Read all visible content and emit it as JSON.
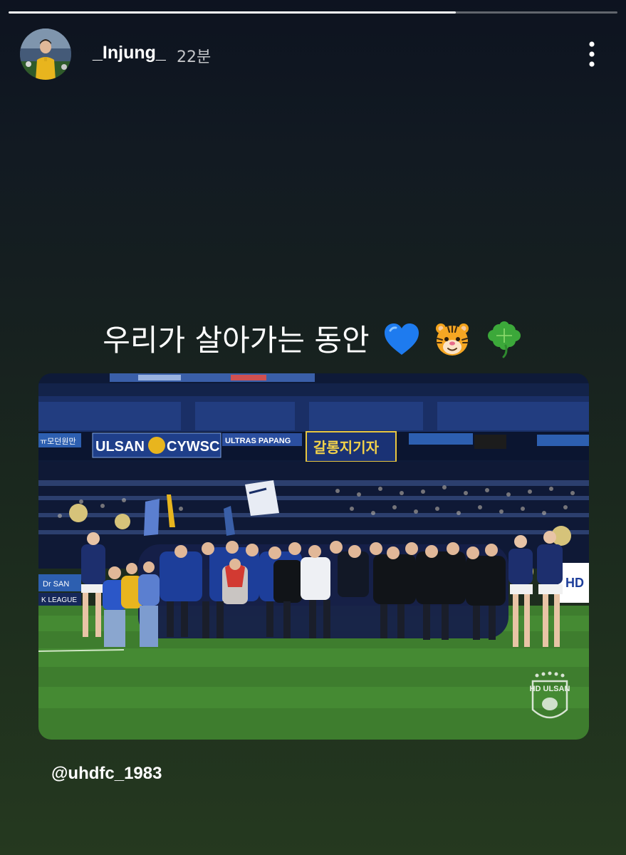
{
  "story": {
    "progress_fraction": 0.735,
    "username": "_Injung_",
    "timestamp": "22분",
    "caption_text": "우리가 살아가는 동안",
    "caption_emojis": [
      "blue-heart-icon",
      "tiger-face-icon",
      "four-leaf-clover-icon"
    ],
    "mention": "@uhdfc_1983"
  },
  "photo": {
    "banners": {
      "left": "ULSAN",
      "left2": "CYWSC",
      "middle": "ULTRAS PAPANG",
      "center": "갈롱지기자",
      "small_left": "ㅠ모던원만",
      "board_left": "Dr SAN",
      "board_left2": "K LEAGUE",
      "board_right": "HD"
    },
    "crest_text": "HD ULSAN"
  },
  "colors": {
    "accent_kit_blue": "#1d3e9a",
    "pitch_green": "#3e7d2e",
    "stands_navy": "#15244a"
  }
}
